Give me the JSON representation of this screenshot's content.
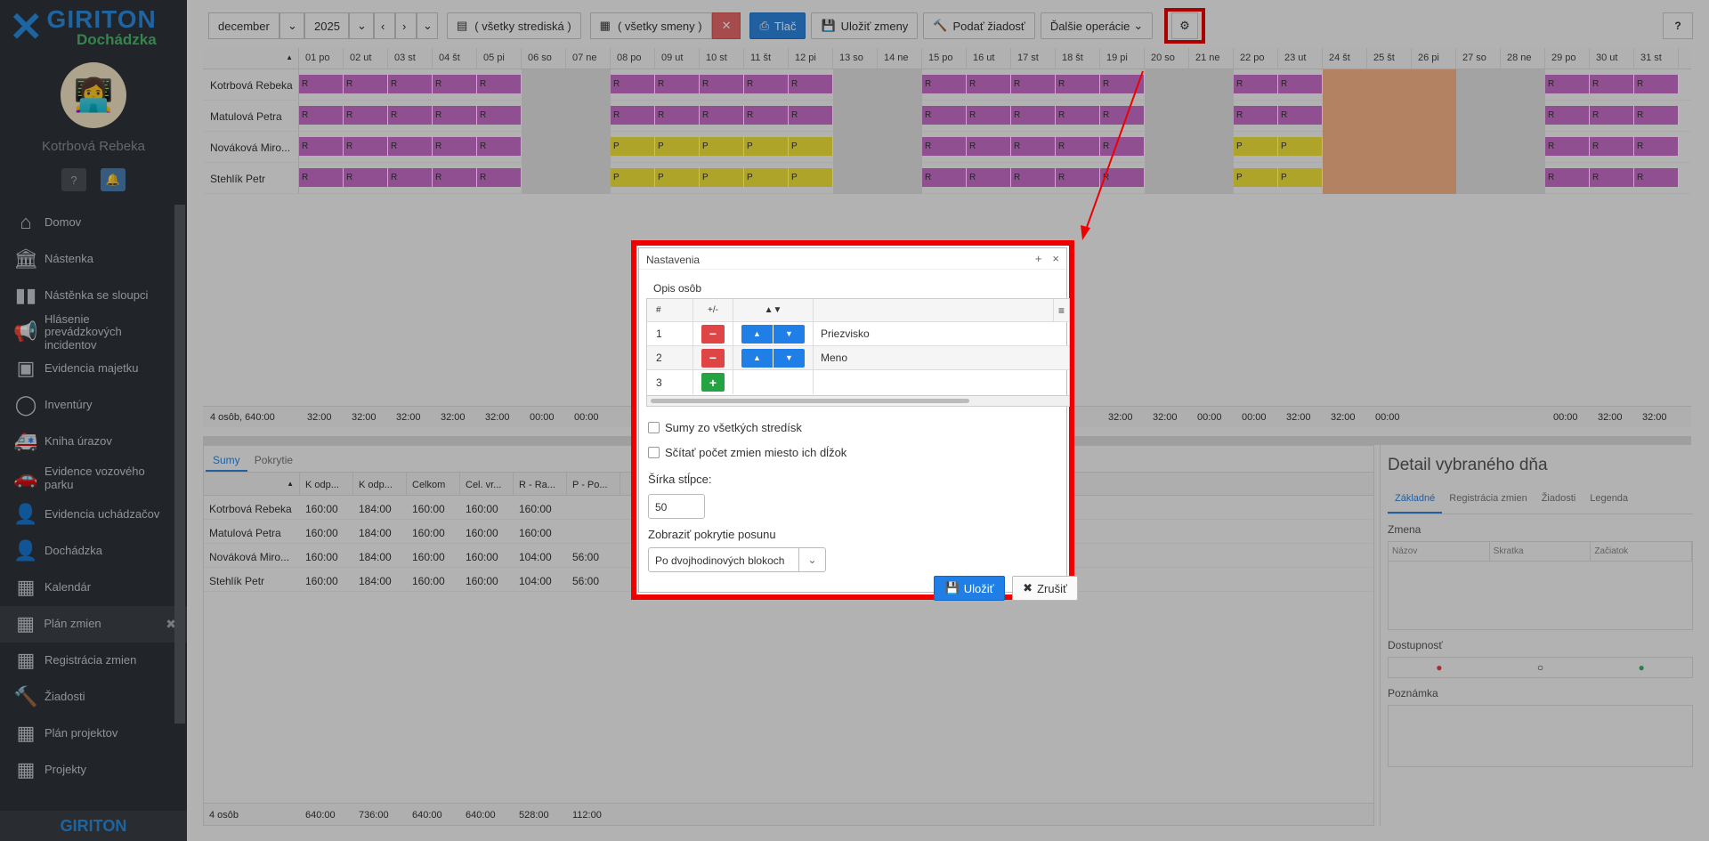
{
  "sidebar": {
    "brand": "GIRITON",
    "product": "Dochádzka",
    "user_name": "Kotrbová Rebeka",
    "items": [
      {
        "label": "Domov",
        "icon": "home-icon",
        "glyph": "⌂"
      },
      {
        "label": "Nástenka",
        "icon": "bank-icon",
        "glyph": "🏛"
      },
      {
        "label": "Nástěnka se sloupci",
        "icon": "columns-icon",
        "glyph": "▮▮"
      },
      {
        "label": "Hlásenie prevádzkových incidentov",
        "icon": "megaphone-icon",
        "glyph": "📢"
      },
      {
        "label": "Evidencia majetku",
        "icon": "box-icon",
        "glyph": "▣"
      },
      {
        "label": "Inventúry",
        "icon": "circle-icon",
        "glyph": "◯"
      },
      {
        "label": "Kniha úrazov",
        "icon": "ambulance-icon",
        "glyph": "🚑"
      },
      {
        "label": "Evidence vozového parku",
        "icon": "car-icon",
        "glyph": "🚗"
      },
      {
        "label": "Evidencia uchádzačov",
        "icon": "user-plus-icon",
        "glyph": "👤"
      },
      {
        "label": "Dochádzka",
        "icon": "user-icon",
        "glyph": "👤"
      },
      {
        "label": "Kalendár",
        "icon": "calendar-icon",
        "glyph": "▦"
      },
      {
        "label": "Plán zmien",
        "icon": "calendar-plan-icon",
        "glyph": "▦"
      },
      {
        "label": "Registrácia zmien",
        "icon": "calendar-check-icon",
        "glyph": "▦"
      },
      {
        "label": "Žiadosti",
        "icon": "gavel-icon",
        "glyph": "🔨"
      },
      {
        "label": "Plán projektov",
        "icon": "calendar-project-icon",
        "glyph": "▦"
      },
      {
        "label": "Projekty",
        "icon": "calendar-projects-icon",
        "glyph": "▦"
      }
    ],
    "active_index": 11,
    "footer": "GIRITON"
  },
  "toolbar": {
    "month": "december",
    "year": "2025",
    "center_filter": "( všetky strediská )",
    "shift_filter": "( všetky smeny )",
    "print": "Tlač",
    "save_changes": "Uložiť zmeny",
    "submit_request": "Podať žiadosť",
    "more_ops": "Ďalšie operácie",
    "help": "?"
  },
  "plan": {
    "days": [
      "01 po",
      "02 ut",
      "03 st",
      "04 št",
      "05 pi",
      "06 so",
      "07 ne",
      "08 po",
      "09 ut",
      "10 st",
      "11 št",
      "12 pi",
      "13 so",
      "14 ne",
      "15 po",
      "16 ut",
      "17 st",
      "18 št",
      "19 pi",
      "20 so",
      "21 ne",
      "22 po",
      "23 ut",
      "24 št",
      "25 št",
      "26 pi",
      "27 so",
      "28 ne",
      "29 po",
      "30 ut",
      "31 st"
    ],
    "rows": [
      {
        "name": "Kotrbová Rebeka",
        "cells": "RRRRRwwRRRRRwwRRRRRwwRRvvvwwRRR"
      },
      {
        "name": "Matulová Petra",
        "cells": "RRRRRwwRRRRRwwRRRRRwwRRvvvwwRRR"
      },
      {
        "name": "Nováková Miro...",
        "cells": "RRRRRwwPPPPPwwRRRRRwwPPvvvwwRRR"
      },
      {
        "name": "Stehlík Petr",
        "cells": "RRRRRwwPPPPPwwRRRRRwwPPvvvwwRRR"
      }
    ],
    "totals_label": "4 osôb, 640:00",
    "totals": [
      "32:00",
      "32:00",
      "32:00",
      "32:00",
      "32:00",
      "00:00",
      "00:00",
      "",
      "",
      "",
      "",
      "",
      "",
      "",
      "",
      "",
      "",
      "",
      "32:00",
      "32:00",
      "00:00",
      "00:00",
      "32:00",
      "32:00",
      "00:00",
      "",
      "",
      "",
      "00:00",
      "32:00",
      "32:00"
    ]
  },
  "summary": {
    "tabs": [
      "Sumy",
      "Pokrytie"
    ],
    "headers": [
      "K odp...",
      "K odp...",
      "Celkom",
      "Cel. vr...",
      "R - Ra...",
      "P - Po..."
    ],
    "rows": [
      {
        "name": "Kotrbová Rebeka",
        "vals": [
          "160:00",
          "184:00",
          "160:00",
          "160:00",
          "160:00",
          ""
        ]
      },
      {
        "name": "Matulová Petra",
        "vals": [
          "160:00",
          "184:00",
          "160:00",
          "160:00",
          "160:00",
          ""
        ]
      },
      {
        "name": "Nováková Miro...",
        "vals": [
          "160:00",
          "184:00",
          "160:00",
          "160:00",
          "104:00",
          "56:00"
        ]
      },
      {
        "name": "Stehlík Petr",
        "vals": [
          "160:00",
          "184:00",
          "160:00",
          "160:00",
          "104:00",
          "56:00"
        ]
      }
    ],
    "footer_label": "4 osôb",
    "footer": [
      "640:00",
      "736:00",
      "640:00",
      "640:00",
      "528:00",
      "112:00"
    ]
  },
  "detail": {
    "title": "Detail vybraného dňa",
    "tabs": [
      "Základné",
      "Registrácia zmien",
      "Žiadosti",
      "Legenda"
    ],
    "shift_label": "Zmena",
    "columns": [
      "Názov",
      "Skratka",
      "Začiatok"
    ],
    "availability_label": "Dostupnosť",
    "note_label": "Poznámka"
  },
  "dialog": {
    "title": "Nastavenia",
    "section": "Opis osôb",
    "col_hash": "#",
    "col_plusminus": "+/-",
    "col_order": "▲▼",
    "rows": [
      {
        "num": "1",
        "value": "Priezvisko"
      },
      {
        "num": "2",
        "value": "Meno"
      }
    ],
    "new_row_num": "3",
    "check_all_centers": "Sumy zo všetkých stredísk",
    "check_count_shifts": "Sčítať počet zmien miesto ich dĺžok",
    "column_width_label": "Šírka stĺpce:",
    "column_width_value": "50",
    "coverage_label": "Zobraziť pokrytie posunu",
    "coverage_value": "Po dvojhodinových blokoch",
    "save": "Uložiť",
    "cancel": "Zrušiť"
  },
  "colors": {
    "red_highlight": "#ee0000",
    "shift_R": "#c86ec9",
    "shift_P": "#f3e33b",
    "vacation": "#f7b48a",
    "primary": "#1f7fe6"
  }
}
